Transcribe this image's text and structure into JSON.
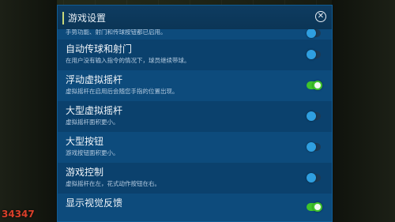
{
  "dialog": {
    "title": "游戏设置",
    "close_glyph": "✕"
  },
  "settings": [
    {
      "title": "",
      "desc": "手势功能、射门和传球按钮都已启用。",
      "enabled": false
    },
    {
      "title": "自动传球和射门",
      "desc": "在用户没有输入指令的情况下，球员继续带球。",
      "enabled": false
    },
    {
      "title": "浮动虚拟摇杆",
      "desc": "虚拟摇杆在启用后会随您手指的位置出现。",
      "enabled": true
    },
    {
      "title": "大型虚拟摇杆",
      "desc": "虚拟摇杆面积更小。",
      "enabled": false
    },
    {
      "title": "大型按钮",
      "desc": "游戏按钮面积更小。",
      "enabled": false
    },
    {
      "title": "游戏控制",
      "desc": "虚拟摇杆在左，花式动作按钮在右。",
      "enabled": false
    },
    {
      "title": "显示视觉反馈",
      "desc": "",
      "enabled": true
    }
  ],
  "watermark": "34347"
}
